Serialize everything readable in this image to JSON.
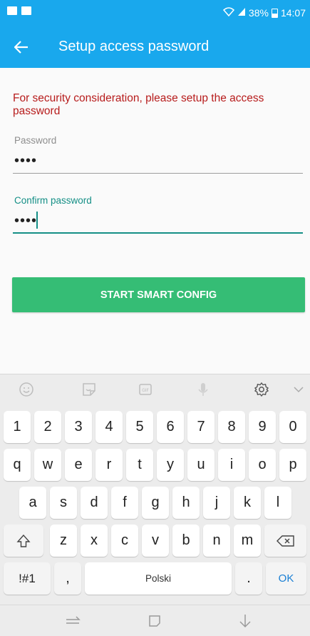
{
  "status_bar": {
    "battery_percent": "38%",
    "time": "14:07"
  },
  "header": {
    "title": "Setup access password"
  },
  "form": {
    "notice": "For security consideration, please setup the access password",
    "password_label": "Password",
    "password_value": "••••",
    "confirm_label": "Confirm password",
    "confirm_value": "••••",
    "start_button": "START SMART CONFIG"
  },
  "keyboard": {
    "toolbar_icons": [
      "emoji-icon",
      "sticker-icon",
      "gif-icon",
      "microphone-icon",
      "settings-icon",
      "collapse-icon"
    ],
    "row_numbers": [
      "1",
      "2",
      "3",
      "4",
      "5",
      "6",
      "7",
      "8",
      "9",
      "0"
    ],
    "row_top": [
      "q",
      "w",
      "e",
      "r",
      "t",
      "y",
      "u",
      "i",
      "o",
      "p"
    ],
    "row_middle": [
      "a",
      "s",
      "d",
      "f",
      "g",
      "h",
      "j",
      "k",
      "l"
    ],
    "row_bottom": [
      "z",
      "x",
      "c",
      "v",
      "b",
      "n",
      "m"
    ],
    "symbols_key": "!#1",
    "comma_key": ",",
    "space_key": "Polski",
    "period_key": ".",
    "ok_key": "OK"
  },
  "colors": {
    "header": "#19a8ed",
    "accent": "#148f86",
    "notice": "#b71c1c",
    "button": "#35bd75",
    "ok_key": "#1a7fd4"
  }
}
